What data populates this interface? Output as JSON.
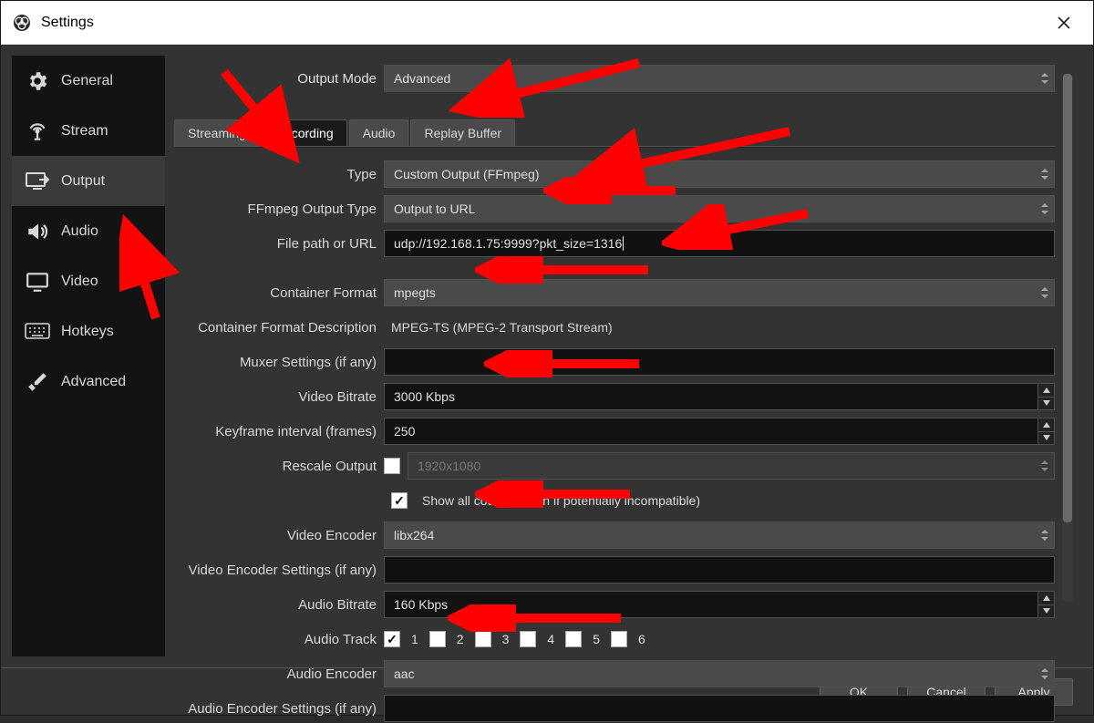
{
  "window": {
    "title": "Settings"
  },
  "sidebar": {
    "items": [
      {
        "label": "General"
      },
      {
        "label": "Stream"
      },
      {
        "label": "Output"
      },
      {
        "label": "Audio"
      },
      {
        "label": "Video"
      },
      {
        "label": "Hotkeys"
      },
      {
        "label": "Advanced"
      }
    ]
  },
  "outputMode": {
    "label": "Output Mode",
    "value": "Advanced"
  },
  "tabs": [
    {
      "label": "Streaming"
    },
    {
      "label": "Recording"
    },
    {
      "label": "Audio"
    },
    {
      "label": "Replay Buffer"
    }
  ],
  "fields": {
    "type": {
      "label": "Type",
      "value": "Custom Output (FFmpeg)"
    },
    "ffmpegOutput": {
      "label": "FFmpeg Output Type",
      "value": "Output to URL"
    },
    "filePath": {
      "label": "File path or URL",
      "value": "udp://192.168.1.75:9999?pkt_size=1316"
    },
    "container": {
      "label": "Container Format",
      "value": "mpegts"
    },
    "containerDesc": {
      "label": "Container Format Description",
      "value": "MPEG-TS (MPEG-2 Transport Stream)"
    },
    "muxer": {
      "label": "Muxer Settings (if any)",
      "value": ""
    },
    "videoBitrate": {
      "label": "Video Bitrate",
      "value": "3000 Kbps"
    },
    "keyframe": {
      "label": "Keyframe interval (frames)",
      "value": "250"
    },
    "rescale": {
      "label": "Rescale Output",
      "placeholder": "1920x1080",
      "checked": false
    },
    "showAll": {
      "label": "Show all codecs (even if potentially incompatible)",
      "checked": true
    },
    "videoEncoder": {
      "label": "Video Encoder",
      "value": "libx264"
    },
    "videoEncSettings": {
      "label": "Video Encoder Settings (if any)",
      "value": ""
    },
    "audioBitrate": {
      "label": "Audio Bitrate",
      "value": "160 Kbps"
    },
    "audioTrack": {
      "label": "Audio Track",
      "tracks": [
        "1",
        "2",
        "3",
        "4",
        "5",
        "6"
      ],
      "checked": 1
    },
    "audioEncoder": {
      "label": "Audio Encoder",
      "value": "aac"
    },
    "audioEncSettings": {
      "label": "Audio Encoder Settings (if any)",
      "value": ""
    }
  },
  "footer": {
    "ok": "OK",
    "cancel": "Cancel",
    "apply": "Apply"
  }
}
